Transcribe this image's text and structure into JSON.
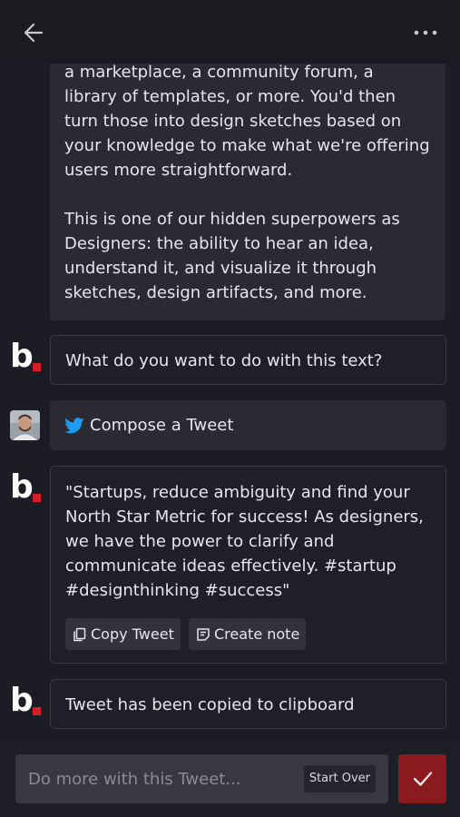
{
  "header": {
    "back_icon": "arrow-left-icon",
    "menu_icon": "more-horizontal-icon"
  },
  "messages": {
    "assistant_long_text": "a marketplace, a community forum, a library of templates, or more. You'd then turn those into design sketches based on your knowledge to make what we're offering users more straightforward.\n\nThis is one of our hidden superpowers as Designers: the ability to hear an idea, understand it, and visualize it through sketches, design artifacts, and more.",
    "assistant_question": "What do you want to do with this text?",
    "user_action": "Compose a Tweet",
    "tweet_text": "\"Startups, reduce ambiguity and find your North Star Metric for success! As designers, we have the power to clarify and communicate ideas effectively. #startup #designthinking #success\"",
    "copy_tweet_label": "Copy Tweet",
    "create_note_label": "Create note",
    "copied_confirmation": "Tweet has been copied to clipboard"
  },
  "composer": {
    "placeholder": "Do more with this Tweet...",
    "start_over_label": "Start Over",
    "send_icon": "checkmark-icon"
  },
  "colors": {
    "background": "#1c1c24",
    "bubble": "#2a2a33",
    "accent_red": "#d61f26",
    "send_button": "#8b1a1f",
    "twitter_blue": "#1d9bf0"
  }
}
